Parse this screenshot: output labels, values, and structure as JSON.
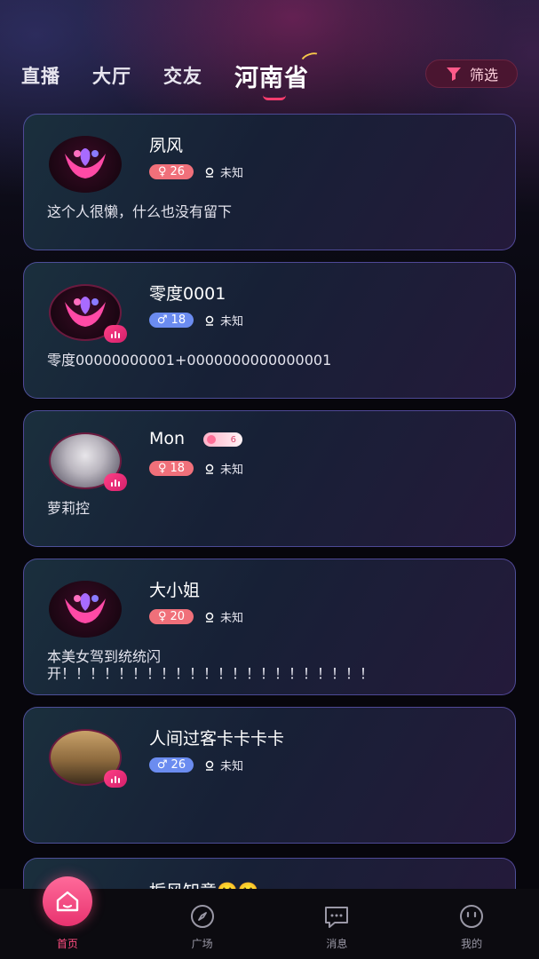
{
  "tabs": [
    {
      "label": "直播"
    },
    {
      "label": "大厅"
    },
    {
      "label": "交友"
    },
    {
      "label": "河南省",
      "active": true
    }
  ],
  "filter": {
    "label": "筛选",
    "icon": "funnel-icon"
  },
  "users": [
    {
      "name": "夙风",
      "gender": "female",
      "age": "26",
      "location": "未知",
      "bio": "这个人很懒，什么也没有留下",
      "avatar": "app-logo",
      "live": false
    },
    {
      "name": "零度0001",
      "gender": "male",
      "age": "18",
      "location": "未知",
      "bio": "零度00000000001+0000000000000001",
      "avatar": "app-logo",
      "live": true
    },
    {
      "name": "Mon",
      "gender": "female",
      "age": "18",
      "location": "未知",
      "bio": "萝莉控",
      "avatar": "photo-girl",
      "live": true,
      "level": "6"
    },
    {
      "name": "大小姐",
      "gender": "female",
      "age": "20",
      "location": "未知",
      "bio": "本美女驾到统统闪开！！！！！！！！！！！！！！！！！！！！！！",
      "avatar": "app-logo",
      "live": false
    },
    {
      "name": "人间过客卡卡卡卡",
      "gender": "male",
      "age": "26",
      "location": "未知",
      "bio": "",
      "avatar": "photo-cat",
      "live": true
    },
    {
      "name": "栀风知意🙂🙂",
      "gender": "",
      "age": "",
      "location": "",
      "bio": "",
      "avatar": "app-logo",
      "live": false
    }
  ],
  "nav": [
    {
      "label": "首页",
      "icon": "home-icon",
      "active": true
    },
    {
      "label": "广场",
      "icon": "compass-icon"
    },
    {
      "label": "消息",
      "icon": "message-icon"
    },
    {
      "label": "我的",
      "icon": "profile-icon"
    }
  ],
  "colors": {
    "accent": "#ff4d80",
    "female": "#f0707a",
    "male": "#6b8cf0"
  }
}
